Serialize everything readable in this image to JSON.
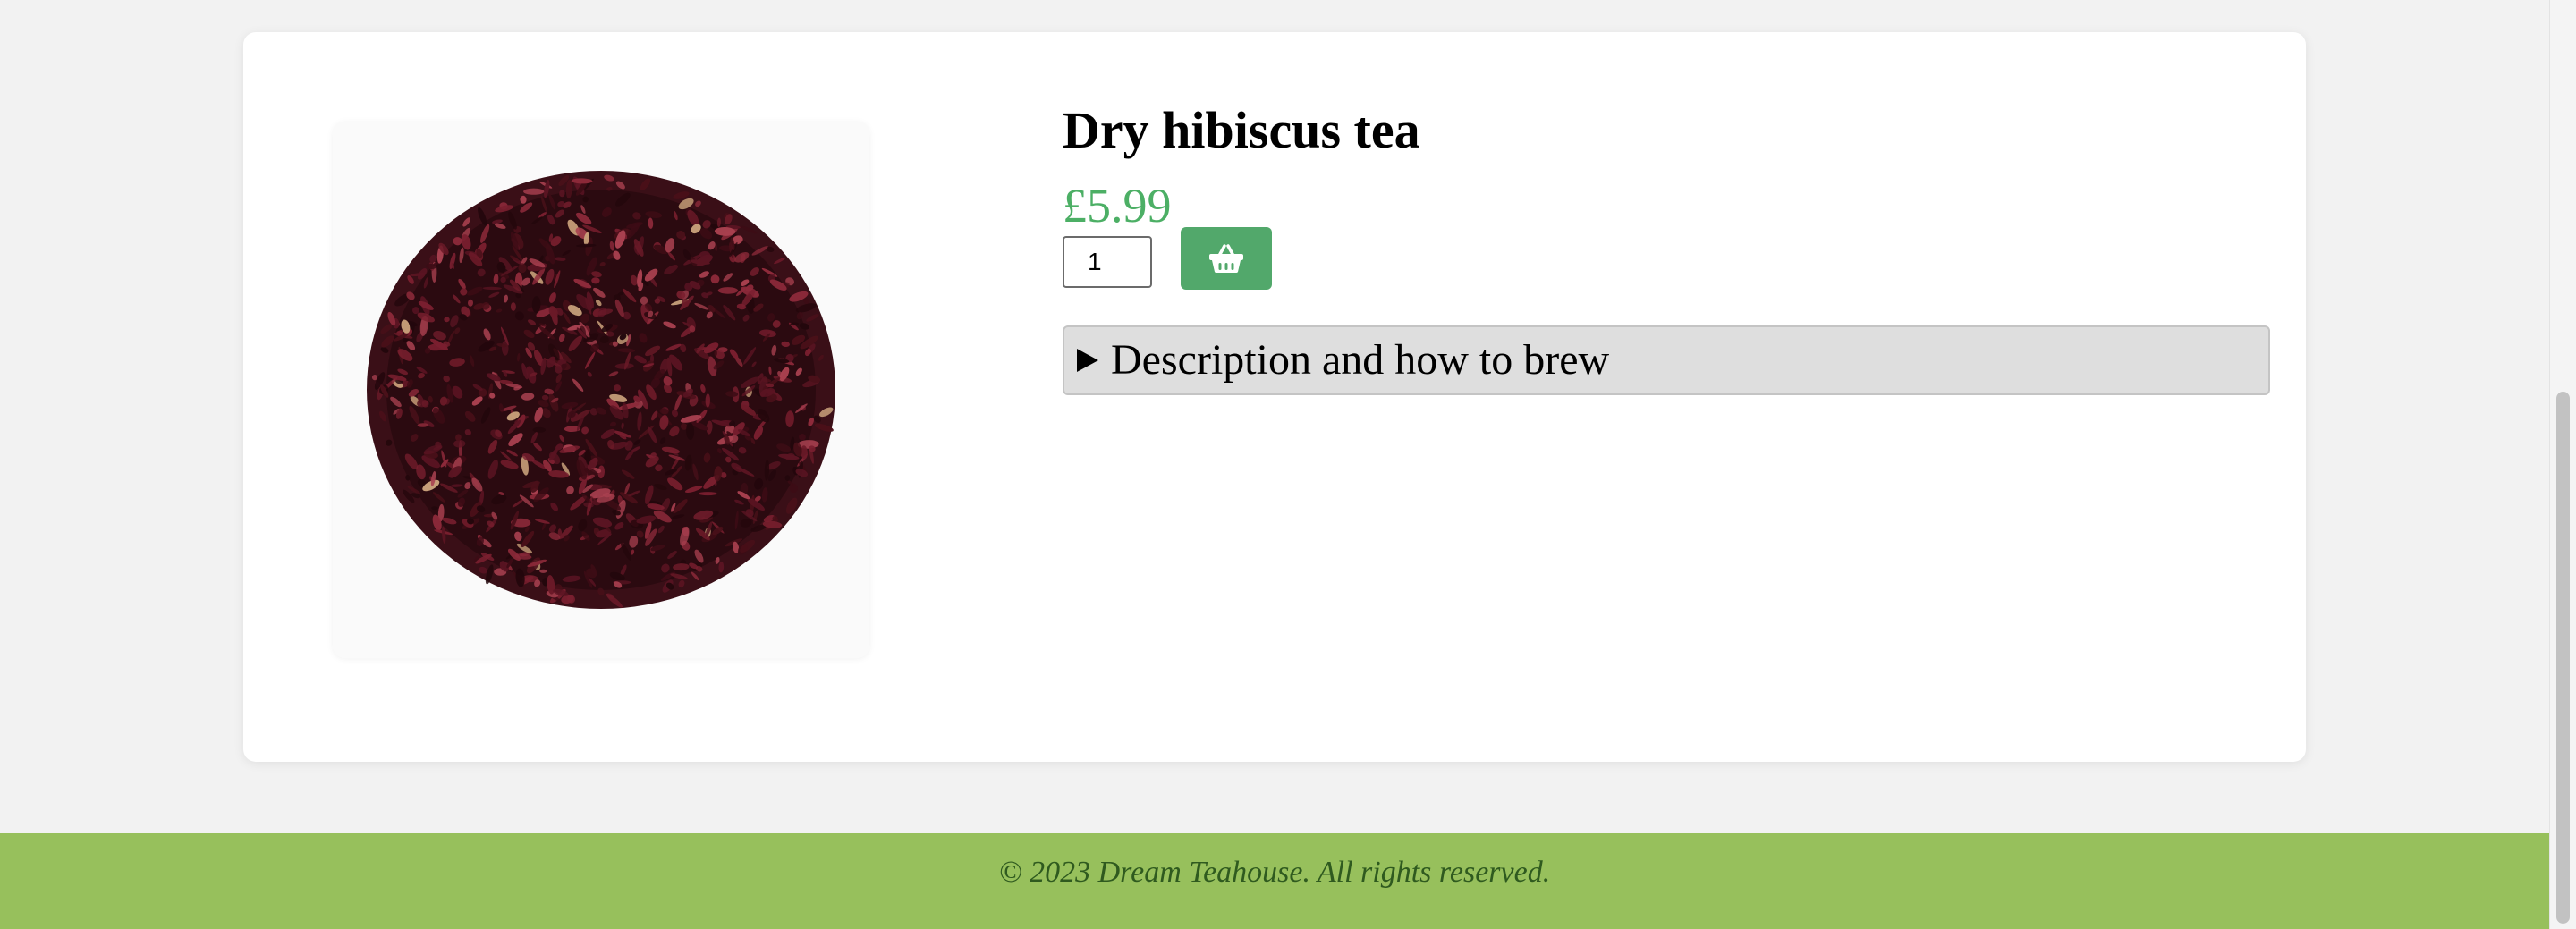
{
  "product": {
    "title": "Dry hibiscus tea",
    "price": "£5.99",
    "image_alt": "Dry hibiscus tea leaves",
    "quantity": "1"
  },
  "actions": {
    "add_to_basket_icon": "basket-icon"
  },
  "details": {
    "summary_label": "Description and how to brew",
    "expanded": false
  },
  "footer": {
    "copyright": "© 2023 Dream Teahouse. All rights reserved."
  },
  "colors": {
    "price": "#4caf65",
    "basket_button": "#52a86b",
    "footer_background": "#97c05c",
    "footer_text": "#2f5a1f",
    "details_background": "#dedede"
  }
}
